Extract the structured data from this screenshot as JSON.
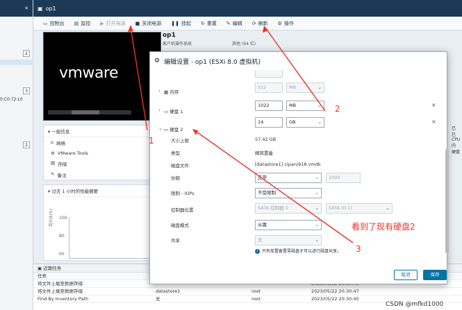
{
  "sidebar": {
    "badges": [
      "2",
      "3",
      "2"
    ],
    "text": "0:C0:72:L0"
  },
  "header": {
    "vm_tab": "op1"
  },
  "toolbar": {
    "items": [
      "控制台",
      "监控",
      "打开电源",
      "关闭电源",
      "挂起",
      "重置",
      "编辑",
      "刷新",
      "操作"
    ]
  },
  "vm": {
    "name": "op1",
    "os_label": "客户机操作系统",
    "os_value": "其他 (64 位)",
    "logo": "vmware"
  },
  "info": {
    "header": "一般信息",
    "rows": [
      "网络",
      "VMware Tools",
      "存储",
      "备注"
    ]
  },
  "perf": {
    "header": "过去 1 小时的性能摘要",
    "ylabel": "百分比(%)",
    "yticks": [
      "100",
      "80",
      "60"
    ]
  },
  "tasks": {
    "header": "近期任务",
    "col_header": "任务",
    "rows": [
      {
        "task": "将文件上载至数据存储",
        "target": "",
        "initiator": "",
        "time": "2023/05/22 20:30:48"
      },
      {
        "task": "将文件上载至数据存储",
        "target": "datastore1",
        "initiator": "root",
        "time": "2023/05/22 20:30:47"
      },
      {
        "task": "Find By Inventory Path",
        "target": "无",
        "initiator": "root",
        "time": "2023/05/22 20:30:45"
      }
    ]
  },
  "right_strip": [
    "已",
    "已",
    "CPU",
    "内",
    "硬盘"
  ],
  "dialog": {
    "title": "编辑设置 - op1 (ESXi 8.0 虚拟机)",
    "memory_label": "内存",
    "memory_value": "512",
    "memory_unit": "MB",
    "disk1_label": "硬盘 1",
    "disk1_value": "1022",
    "disk1_unit": "MB",
    "disk2_label": "硬盘 2",
    "disk2_value": "14",
    "disk2_unit": "GB",
    "max_size_label": "大小上限",
    "max_size_value": "57.42 GB",
    "type_label": "类型",
    "type_value": "精简置备",
    "file_label": "磁盘文件",
    "file_value": "[datastore1] cipan/918.vmdk",
    "shares_label": "份额",
    "shares_value": "正常",
    "shares_num": "1000",
    "iops_label": "限制 - IOPs",
    "iops_value": "不受限制",
    "controller_label": "控制器位置",
    "controller_value": "SATA 控制器 0",
    "controller_slot": "SATA (0:1)",
    "mode_label": "磁盘模式",
    "mode_value": "从属",
    "sharing_label": "共享",
    "sharing_value": "无",
    "sharing_note": "只有厚置备置零磁盘才可以进行磁盘共享。",
    "cancel": "取消",
    "save": "保存"
  },
  "annotations": {
    "a1": "1",
    "a2": "2",
    "a3": "3",
    "note": "看到了现有硬盘2"
  },
  "watermark": "CSDN @mfkd1000",
  "colors": {
    "header_bg": "#1c3a56",
    "primary": "#0072a3",
    "annotation": "#e8342a"
  }
}
